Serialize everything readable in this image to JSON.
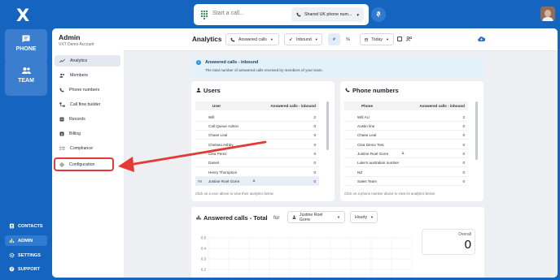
{
  "rail": {
    "logo": "X",
    "phone_label": "PHONE",
    "team_label": "TEAM",
    "links": [
      "CONTACTS",
      "ADMIN",
      "SETTINGS",
      "SUPPORT"
    ]
  },
  "topbar": {
    "call_placeholder": "Start a call...",
    "line_label": "Shared UK phone num..."
  },
  "sidebar": {
    "title": "Admin",
    "subtitle": "VXT Demo Account",
    "items": [
      "Analytics",
      "Members",
      "Phone numbers",
      "Call flow builder",
      "Records",
      "Billing",
      "Compliance",
      "Configuration"
    ]
  },
  "header": {
    "title": "Analytics",
    "filter_calls": "Answered calls",
    "filter_direction": "Inbound",
    "filter_count": "#",
    "filter_percent": "%",
    "filter_date": "Today"
  },
  "info": {
    "title": "Answered calls - inbound",
    "text": "The total number of answered calls received by members of your team."
  },
  "users": {
    "title": "Users",
    "col_user": "User",
    "col_value": "Answered calls - inbound",
    "rows": [
      {
        "name": "Will",
        "value": "2"
      },
      {
        "name": "Call Queue Admin",
        "value": "0"
      },
      {
        "name": "Chase Leal",
        "value": "0"
      },
      {
        "name": "Chelsea Ashby",
        "value": "0"
      },
      {
        "name": "Clea Perez",
        "value": "0"
      },
      {
        "name": "Daniel",
        "value": "0"
      },
      {
        "name": "Henry Thompson",
        "value": "0"
      },
      {
        "name": "Justine Roel Gorre",
        "value": "0",
        "rank": "#8"
      }
    ],
    "footer": "Click on a user above to view their analytics below"
  },
  "phones": {
    "title": "Phone numbers",
    "col_phone": "Phone",
    "col_value": "Answered calls - inbound",
    "rows": [
      {
        "name": "Will AU",
        "value": "2"
      },
      {
        "name": "Austin line",
        "value": "0"
      },
      {
        "name": "Chase Leal",
        "value": "0"
      },
      {
        "name": "Clea Demo Test",
        "value": "0"
      },
      {
        "name": "Justine Roel Gorre",
        "value": "0"
      },
      {
        "name": "Luke's australian number",
        "value": "0"
      },
      {
        "name": "NZ",
        "value": "0"
      },
      {
        "name": "Sales Team",
        "value": "0"
      }
    ],
    "footer": "Click on a phone number above to view its analytics below"
  },
  "total": {
    "title": "Answered calls - Total",
    "for_label": "for",
    "person": "Justine Roel Gorre",
    "interval": "Hourly",
    "overall_label": "Overall",
    "overall_value": "0"
  },
  "chart_data": {
    "type": "line",
    "title": "Answered calls - Total",
    "yticks": [
      "0.5",
      "0.4",
      "0.3",
      "0.2"
    ],
    "series": []
  },
  "colors": {
    "brand": "#1565c0",
    "annotation": "#e53935",
    "info_bg": "#e3f1fa"
  }
}
